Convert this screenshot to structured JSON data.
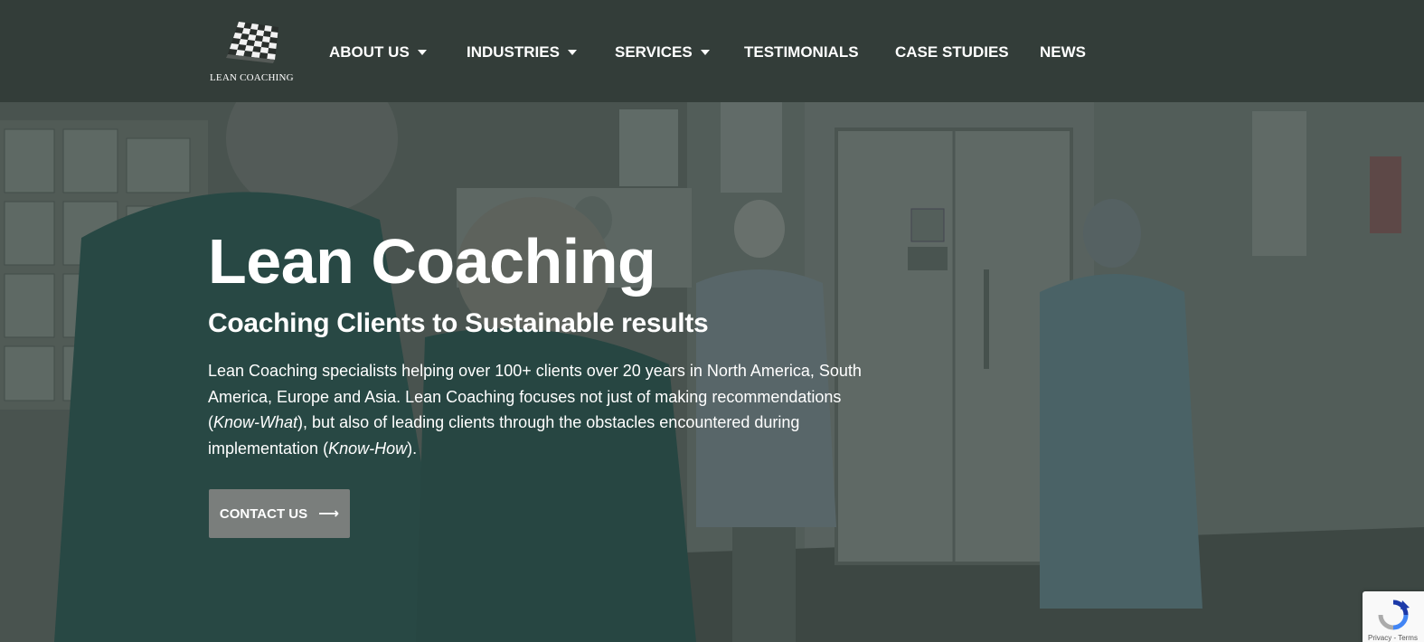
{
  "logo": {
    "text": "LEAN COACHING",
    "icon": "chessboard-icon"
  },
  "nav": [
    {
      "label": "ABOUT US",
      "dropdown": true
    },
    {
      "label": "INDUSTRIES",
      "dropdown": true
    },
    {
      "label": "SERVICES",
      "dropdown": true
    },
    {
      "label": "TESTIMONIALS",
      "dropdown": false
    },
    {
      "label": "CASE STUDIES",
      "dropdown": false
    },
    {
      "label": "NEWS",
      "dropdown": false
    }
  ],
  "hero": {
    "title": "Lean Coaching",
    "subtitle": "Coaching Clients to Sustainable results",
    "body_1": "Lean Coaching specialists helping over 100+ clients over 20 years in North America, South America, Europe and Asia. Lean Coaching focuses not just of making recommendations (",
    "body_em_1": "Know-What",
    "body_2": "), but also of leading clients through the obstacles encountered during implementation (",
    "body_em_2": "Know-How",
    "body_3": ").",
    "cta_label": "CONTACT US",
    "cta_icon": "arrow-right-icon"
  },
  "recaptcha": {
    "links": "Privacy - Terms"
  },
  "colors": {
    "header_bg": "#333d39",
    "button_bg": "#7a7e7c",
    "text": "#ffffff"
  }
}
